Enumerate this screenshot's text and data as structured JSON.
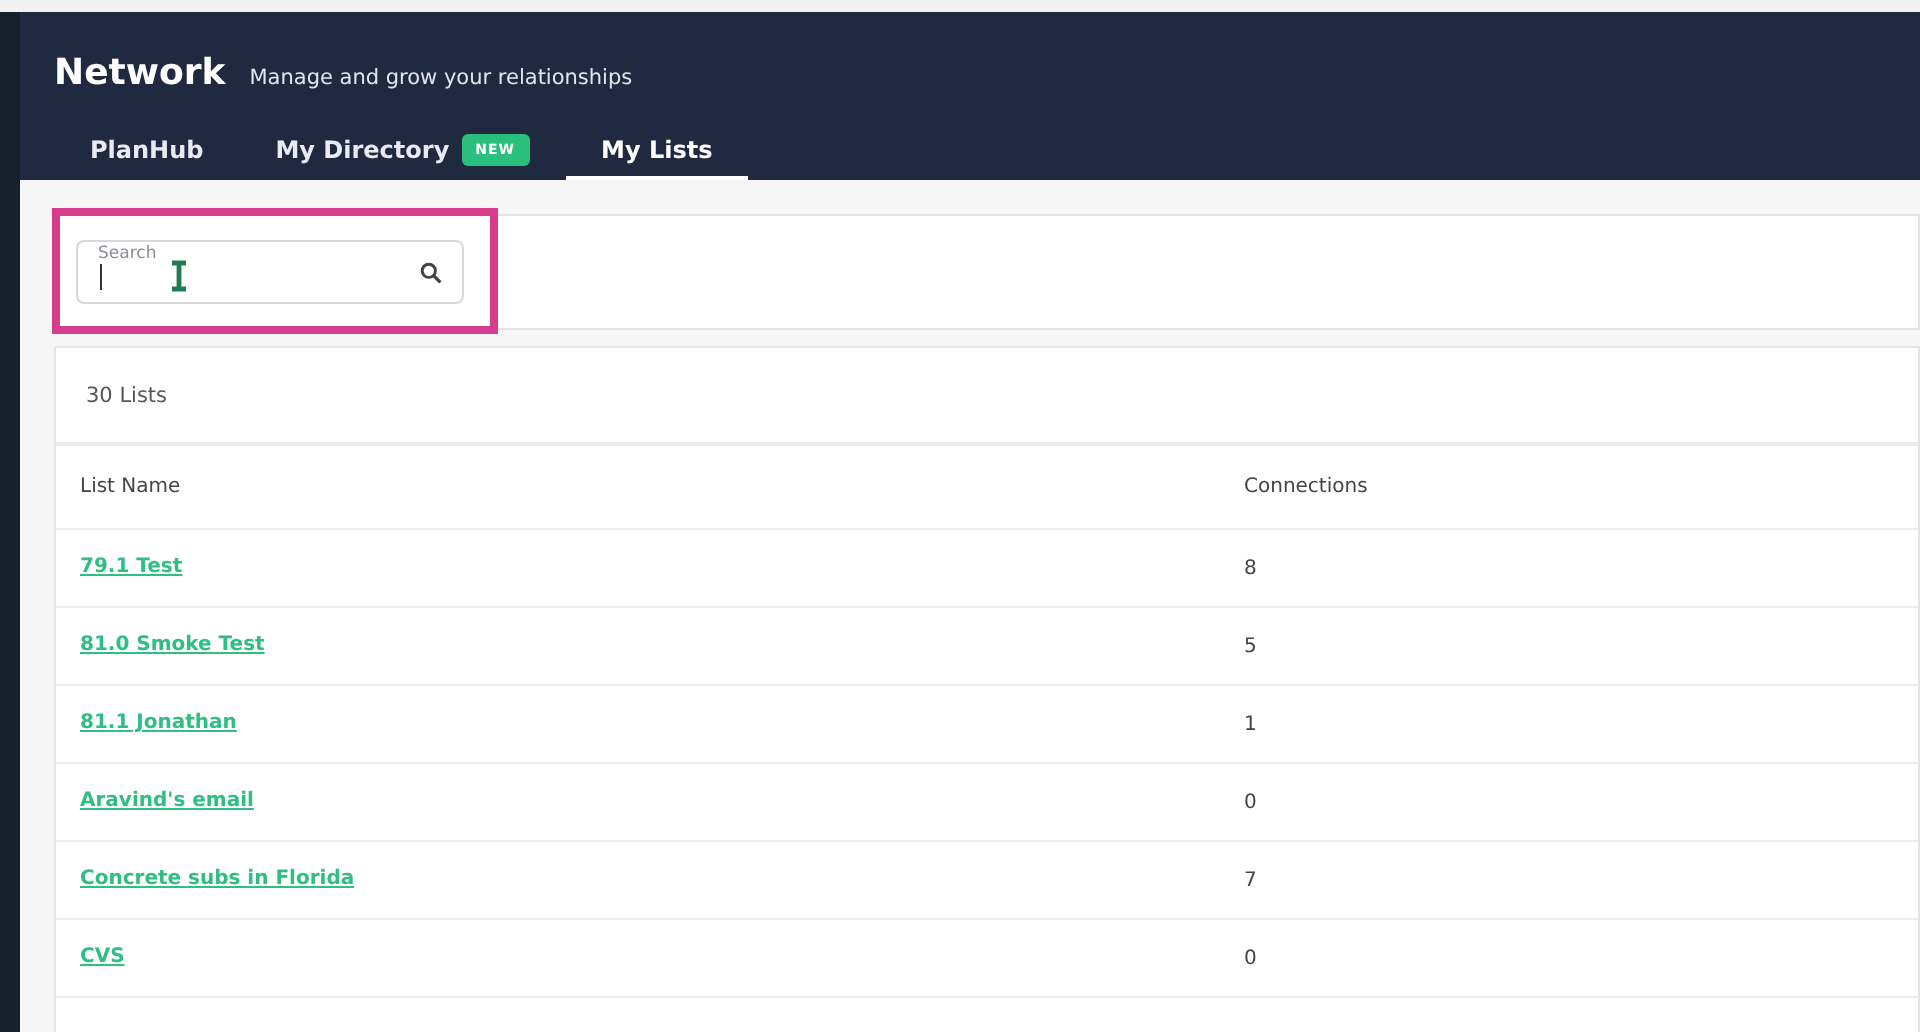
{
  "header": {
    "title": "Network",
    "subtitle": "Manage and grow your relationships"
  },
  "tabs": [
    {
      "label": "PlanHub",
      "selected": false
    },
    {
      "label": "My Directory",
      "selected": false,
      "badge": "NEW"
    },
    {
      "label": "My Lists",
      "selected": true
    }
  ],
  "search": {
    "placeholder": "Search",
    "highlighted": true
  },
  "table": {
    "count": "30 Lists",
    "columns": [
      "List Name",
      "Connections"
    ],
    "rows": [
      {
        "name": "79.1 Test",
        "connections": "8"
      },
      {
        "name": "81.0 Smoke Test",
        "connections": "5"
      },
      {
        "name": "81.1 Jonathan",
        "connections": "1"
      },
      {
        "name": "Aravind's email",
        "connections": "0"
      },
      {
        "name": "Concrete subs in Florida",
        "connections": "7"
      },
      {
        "name": "CVS",
        "connections": "0"
      }
    ]
  }
}
